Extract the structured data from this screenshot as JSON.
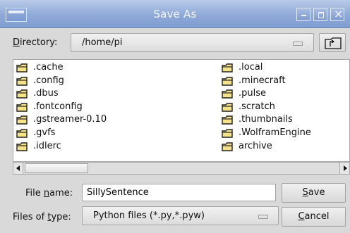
{
  "window": {
    "title": "Save As"
  },
  "directory": {
    "label_accel": "D",
    "label_rest": "irectory:",
    "value": "/home/pi"
  },
  "files": {
    "left_column": [
      ".cache",
      ".config",
      ".dbus",
      ".fontconfig",
      ".gstreamer-0.10",
      ".gvfs",
      ".idlerc"
    ],
    "right_column": [
      ".local",
      ".minecraft",
      ".pulse",
      ".scratch",
      ".thumbnails",
      ".WolframEngine",
      "archive"
    ]
  },
  "filename": {
    "label_pre": "File ",
    "label_accel": "n",
    "label_post": "ame:",
    "value": "SillySentence"
  },
  "filetype": {
    "label_pre": "Files of ",
    "label_accel": "t",
    "label_post": "ype:",
    "value": "Python files (*.py,*.pyw)"
  },
  "buttons": {
    "save_accel": "S",
    "save_rest": "ave",
    "cancel_accel": "C",
    "cancel_rest": "ancel"
  },
  "colors": {
    "titlebar": "#8fa9d8",
    "folder_outline": "#222222",
    "folder_fill": "#f3e28a"
  }
}
